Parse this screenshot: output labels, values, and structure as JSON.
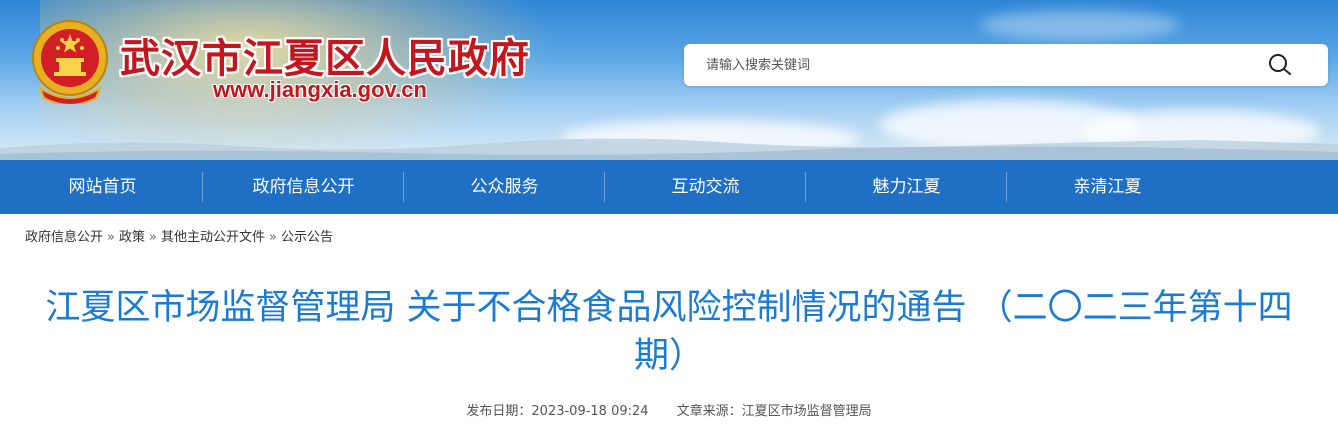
{
  "header": {
    "site_title": "武汉市江夏区人民政府",
    "site_url": "www.jiangxia.gov.cn",
    "emblem_icon": "national-emblem-icon",
    "search": {
      "placeholder": "请输入搜索关键词",
      "value": "",
      "button_icon": "search-icon"
    }
  },
  "nav": {
    "items": [
      {
        "label": "网站首页"
      },
      {
        "label": "政府信息公开"
      },
      {
        "label": "公众服务"
      },
      {
        "label": "互动交流"
      },
      {
        "label": "魅力江夏"
      },
      {
        "label": "亲清江夏"
      }
    ]
  },
  "breadcrumb": {
    "items": [
      "政府信息公开",
      "政策",
      "其他主动公开文件",
      "公示公告"
    ],
    "separator": "»"
  },
  "article": {
    "title": "江夏区市场监督管理局 关于不合格食品风险控制情况的通告 （二〇二三年第十四期）",
    "publish_label": "发布日期：",
    "publish_date": "2023-09-18 09:24",
    "source_label": "文章来源：",
    "source": "江夏区市场监督管理局"
  },
  "colors": {
    "brand_red": "#c4161c",
    "nav_blue": "#1f6fc5",
    "title_blue": "#1a7bd6"
  }
}
